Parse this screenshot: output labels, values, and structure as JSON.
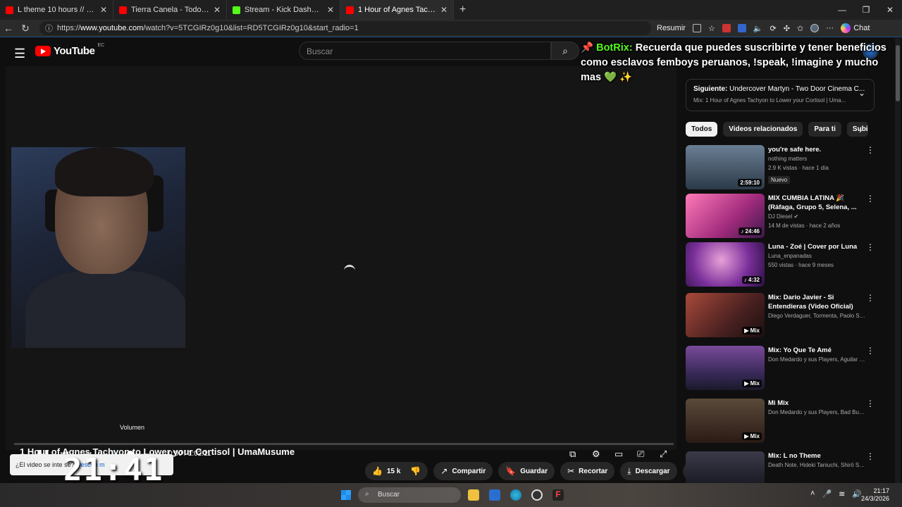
{
  "browser": {
    "tabs": [
      {
        "label": "L theme 10 hours // death note - \\",
        "icon": "youtube-favicon",
        "active": false
      },
      {
        "label": "Tierra Canela - Todo Lo Tuve Cont",
        "icon": "youtube-favicon",
        "active": false
      },
      {
        "label": "Stream - Kick Dashboard",
        "icon": "kick-favicon",
        "active": false
      },
      {
        "label": "1 Hour of Agnes Tachyon to Lower",
        "icon": "youtube-favicon",
        "active": true
      }
    ],
    "url_prefix": "https://",
    "url_host": "www.youtube.com",
    "url_path": "/watch?v=5TCGIRz0g10&list=RD5TCGIRz0g10&start_radio=1",
    "resumir_label": "Resumir",
    "chat_label": "Chat"
  },
  "youtube": {
    "logo_text": "YouTube",
    "region": "EC",
    "search_placeholder": "Buscar",
    "chat_overlay": {
      "bot_name": "BotRix:",
      "message": "Recuerda que puedes suscribirte y tener beneficios como esclavos femboys peruanos, !speak, !imagine y mucho mas",
      "emotes": "💚 ✨"
    },
    "player": {
      "tooltip": "Volumen",
      "time": "0:00 / 1:02:11",
      "volume_level": 0.25,
      "progress": 0
    },
    "video_title": "1 Hour of Agnes Tachyon to Lower your Cortisol | UmaMusume",
    "popup": {
      "text": "¿El video se inte",
      "text2": "se?",
      "link": "Descub",
      "link2": "m"
    },
    "stream_clock": "21:41",
    "actions": {
      "likes": "15 k",
      "share": "Compartir",
      "save": "Guardar",
      "clip": "Recortar",
      "download": "Descargar"
    },
    "up_next": {
      "label": "Siguiente:",
      "title": "Undercover Martyn - Two Door Cinema C...",
      "mix": "Mix: 1 Hour of Agnes Tachyon to Lower your Cortisol | Uma..."
    },
    "chips": [
      "Todos",
      "Videos relacionados",
      "Para ti",
      "Subi"
    ],
    "recommendations": [
      {
        "title": "you're safe here.",
        "channel": "nothing matters",
        "meta": "2.9 K vistas · hace 1 día",
        "badge": "Nuevo",
        "duration": "2:59:10",
        "thumb": "#3a4a5c"
      },
      {
        "title": "MIX CUMBIA LATINA 🎉 (Ráfaga, Grupo 5, Selena, ...",
        "channel": "DJ Diesel ✔",
        "meta": "14 M de vistas · hace 2 años",
        "badge": "",
        "duration": "♪ 24:46",
        "thumb": "#c2417c"
      },
      {
        "title": "Luna - Zoé | Cover por Luna",
        "channel": "Luna_enpanadas",
        "meta": "550 vistas · hace 9 meses",
        "badge": "",
        "duration": "♪ 4:32",
        "thumb": "#6a2f8a"
      },
      {
        "title": "Mix: Dario Javier - Si Entendieras (Video Oficial)",
        "channel": "Diego Verdaguer, Tormenta, Paolo Salvat...",
        "meta": "",
        "badge": "",
        "duration": "▶ Mix",
        "thumb": "#5a2b2b"
      },
      {
        "title": "Mix: Yo Que Te Amé",
        "channel": "Don Medardo y sus Players, Aguilar Con ...",
        "meta": "",
        "badge": "",
        "duration": "▶ Mix",
        "thumb": "#5b3a6b"
      },
      {
        "title": "Mi Mix",
        "channel": "Don Medardo y sus Players, Bad Bunny, ...",
        "meta": "",
        "badge": "",
        "duration": "▶ Mix",
        "thumb": "#4a3a30"
      },
      {
        "title": "Mix: L no Theme",
        "channel": "Death Note, Hideki Taniuchi, Shirō Sagis...",
        "meta": "",
        "badge": "",
        "duration": "",
        "thumb": "#2a2a3a"
      }
    ]
  },
  "taskbar": {
    "search_placeholder": "Buscar",
    "time": "21:17",
    "date": "24/3/2026"
  }
}
